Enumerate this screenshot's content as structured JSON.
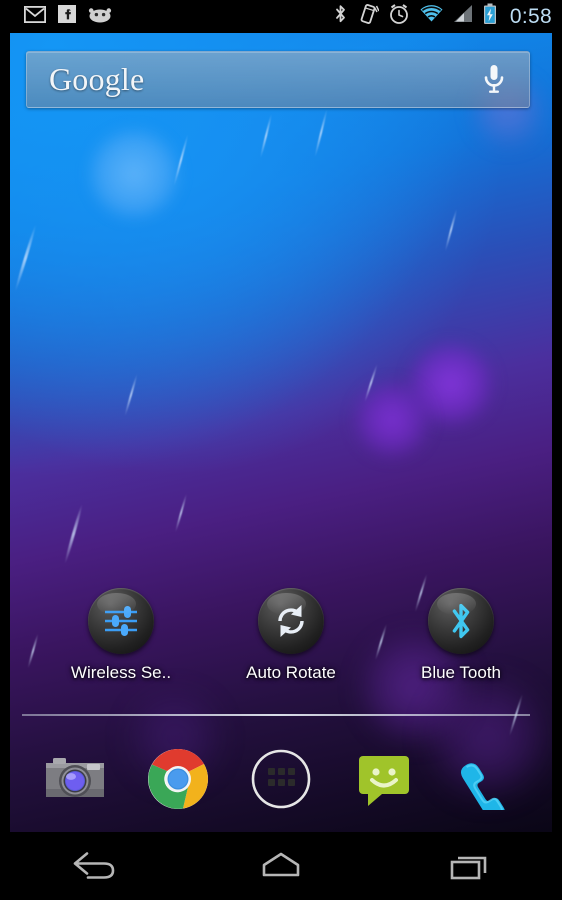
{
  "status_bar": {
    "left_icons": [
      {
        "name": "gmail-icon",
        "label": "Gmail"
      },
      {
        "name": "facebook-icon",
        "label": "Facebook"
      },
      {
        "name": "android-jellybean-icon",
        "label": "Android"
      }
    ],
    "right_icons": [
      {
        "name": "bluetooth-icon",
        "label": "Bluetooth"
      },
      {
        "name": "vibrate-icon",
        "label": "Vibrate"
      },
      {
        "name": "alarm-icon",
        "label": "Alarm"
      },
      {
        "name": "wifi-icon",
        "label": "Wi-Fi"
      },
      {
        "name": "cellular-signal-icon",
        "label": "Signal"
      },
      {
        "name": "battery-charging-icon",
        "label": "Battery charging"
      }
    ],
    "clock": "0:58",
    "clock_color": "#bcdcf2",
    "background": "#000000"
  },
  "search_widget": {
    "text": "Google",
    "mic_icon": "microphone-icon"
  },
  "shortcuts": [
    {
      "label": "Wireless Se..",
      "icon": "sliders-icon",
      "accent": "#3b9df5"
    },
    {
      "label": "Auto Rotate",
      "icon": "rotate-refresh-icon",
      "accent": "#e8eef6"
    },
    {
      "label": "Blue Tooth",
      "icon": "bluetooth-icon",
      "accent": "#3fc7f0"
    }
  ],
  "dock": [
    {
      "label": "Camera",
      "icon": "camera-icon"
    },
    {
      "label": "Chrome",
      "icon": "chrome-icon"
    },
    {
      "label": "Apps",
      "icon": "app-drawer-icon"
    },
    {
      "label": "Messaging",
      "icon": "messaging-icon"
    },
    {
      "label": "Phone",
      "icon": "phone-icon"
    }
  ],
  "nav_bar": [
    {
      "label": "Back",
      "icon": "back-arrow-icon"
    },
    {
      "label": "Home",
      "icon": "home-icon"
    },
    {
      "label": "Recents",
      "icon": "recent-apps-icon"
    }
  ],
  "wallpaper": {
    "name": "nexus-bokeh-wallpaper",
    "top_color": "#1186e8",
    "mid_color": "#4b2f9e",
    "bottom_color": "#0a0616"
  }
}
